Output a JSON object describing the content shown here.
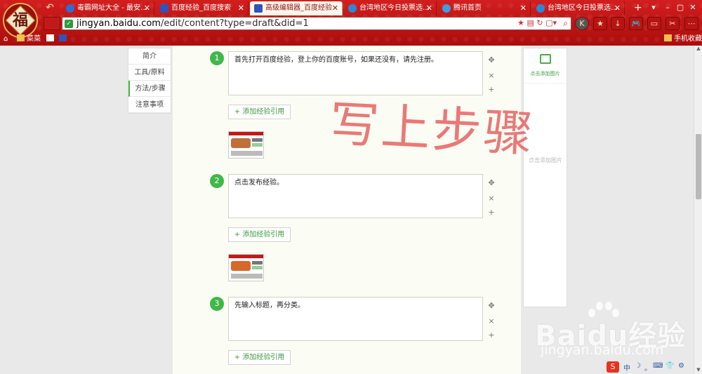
{
  "browser": {
    "tabs": [
      {
        "title": "毒霸网址大全 - 最安…",
        "active": false
      },
      {
        "title": "百度经验_百度搜索",
        "active": false
      },
      {
        "title": "高级编辑器_百度经验",
        "active": true
      },
      {
        "title": "台湾地区今日投票选…",
        "active": false
      },
      {
        "title": "腾讯首页",
        "active": false
      },
      {
        "title": "台湾地区今日投票选…",
        "active": false
      }
    ],
    "url_host": "jingyan.baidu.com",
    "url_path": "/edit/content?type=draft&did=1",
    "bookmarks": {
      "menu": "菜菜",
      "mobile": "手机收藏"
    },
    "logo_char": "福"
  },
  "sidenav": {
    "items": [
      "简介",
      "工具/原料",
      "方法/步骤",
      "注意事项"
    ],
    "active_index": 2
  },
  "steps": [
    {
      "number": "1",
      "text": "首先打开百度经验，登上你的百度账号，如果还没有，请先注册。"
    },
    {
      "number": "2",
      "text": "点击发布经验。"
    },
    {
      "number": "3",
      "text": "先输入标题，再分类。"
    }
  ],
  "ref_button_label": "+ 添加经验引用",
  "right_panel": {
    "add_image_label": "点击添加图片",
    "ghost_text": "点击添加图片"
  },
  "overlay_text": "写上步骤",
  "watermark": {
    "brand": "Baidu经验",
    "site": "jingyan.baidu.com"
  },
  "tray": {
    "items": [
      "中",
      "☽",
      "。",
      "⌨",
      "👕",
      "⚙"
    ]
  },
  "colors": {
    "chrome_red": "#c21a1a",
    "step_green": "#3fb84a",
    "overlay_red": "#e24646"
  }
}
